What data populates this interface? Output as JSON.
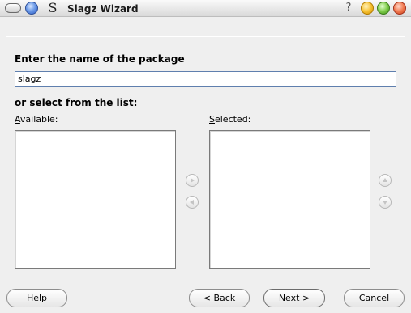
{
  "window": {
    "app_glyph": "S",
    "title": "Slagz Wizard",
    "help_glyph": "?",
    "icons": [
      "window-menu-icon",
      "shade-icon",
      "minimize-icon",
      "maximize-icon",
      "close-icon"
    ]
  },
  "form": {
    "package_label": "Enter the name of the package",
    "package_value": "slagz",
    "select_label": "or select from the list:",
    "available_label_mnemonic": "A",
    "available_label_rest": "vailable:",
    "selected_label_mnemonic": "S",
    "selected_label_rest": "elected:",
    "available_items": [],
    "selected_items": []
  },
  "transfer_buttons": {
    "icons": [
      "arrow-right-icon",
      "arrow-left-icon",
      "arrow-up-icon",
      "arrow-down-icon"
    ]
  },
  "buttons": {
    "help_mnemonic": "H",
    "help_rest": "elp",
    "back_prefix": "< ",
    "back_mnemonic": "B",
    "back_rest": "ack",
    "next_mnemonic": "N",
    "next_rest": "ext >",
    "cancel_mnemonic": "C",
    "cancel_rest": "ancel"
  },
  "colors": {
    "background": "#efefef",
    "input_border": "#5f7fae",
    "shade_button": "#6d9be8",
    "minimize_button": "#f7c234",
    "maximize_button": "#7fcd4b",
    "close_button": "#f17a51"
  }
}
